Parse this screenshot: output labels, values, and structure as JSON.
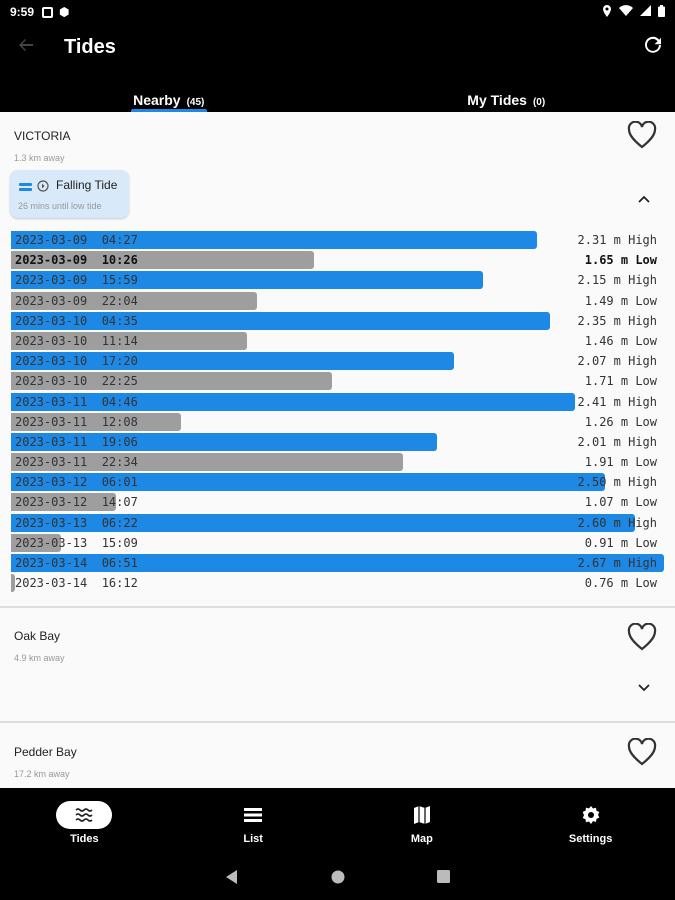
{
  "status_bar": {
    "time": "9:59"
  },
  "app_bar": {
    "title": "Tides"
  },
  "tabs": [
    {
      "label": "Nearby",
      "count": "(45)",
      "active": true
    },
    {
      "label": "My Tides",
      "count": "(0)",
      "active": false
    }
  ],
  "locations": [
    {
      "name": "VICTORIA",
      "distance": "1.3 km away",
      "expanded": true,
      "tide_status": {
        "title": "Falling Tide",
        "subtitle": "26 mins until low tide"
      },
      "tides": [
        {
          "datetime": "2023-03-09  04:27",
          "value": "2.31 m",
          "type": "High",
          "fill": 0.806
        },
        {
          "datetime": "2023-03-09  10:26",
          "value": "1.65 m",
          "type": "Low",
          "fill": 0.464,
          "current": true
        },
        {
          "datetime": "2023-03-09  15:59",
          "value": "2.15 m",
          "type": "High",
          "fill": 0.723
        },
        {
          "datetime": "2023-03-09  22:04",
          "value": "1.49 m",
          "type": "Low",
          "fill": 0.377
        },
        {
          "datetime": "2023-03-10  04:35",
          "value": "2.35 m",
          "type": "High",
          "fill": 0.825
        },
        {
          "datetime": "2023-03-10  11:14",
          "value": "1.46 m",
          "type": "Low",
          "fill": 0.362
        },
        {
          "datetime": "2023-03-10  17:20",
          "value": "2.07 m",
          "type": "High",
          "fill": 0.679
        },
        {
          "datetime": "2023-03-10  22:25",
          "value": "1.71 m",
          "type": "Low",
          "fill": 0.491
        },
        {
          "datetime": "2023-03-11  04:46",
          "value": "2.41 m",
          "type": "High",
          "fill": 0.863
        },
        {
          "datetime": "2023-03-11  12:08",
          "value": "1.26 m",
          "type": "Low",
          "fill": 0.261
        },
        {
          "datetime": "2023-03-11  19:06",
          "value": "2.01 m",
          "type": "High",
          "fill": 0.652
        },
        {
          "datetime": "2023-03-11  22:34",
          "value": "1.91 m",
          "type": "Low",
          "fill": 0.6
        },
        {
          "datetime": "2023-03-12  06:01",
          "value": "2.50 m",
          "type": "High",
          "fill": 0.909
        },
        {
          "datetime": "2023-03-12  14:07",
          "value": "1.07 m",
          "type": "Low",
          "fill": 0.161
        },
        {
          "datetime": "2023-03-13  06:22",
          "value": "2.60 m",
          "type": "High",
          "fill": 0.955
        },
        {
          "datetime": "2023-03-13  15:09",
          "value": "0.91 m",
          "type": "Low",
          "fill": 0.076
        },
        {
          "datetime": "2023-03-14  06:51",
          "value": "2.67 m",
          "type": "High",
          "fill": 1.0
        },
        {
          "datetime": "2023-03-14  16:12",
          "value": "0.76 m",
          "type": "Low",
          "fill": 0.005
        }
      ]
    },
    {
      "name": "Oak Bay",
      "distance": "4.9 km away",
      "expanded": false
    },
    {
      "name": "Pedder Bay",
      "distance": "17.2 km away",
      "expanded": false
    }
  ],
  "bottom_nav": [
    {
      "label": "Tides",
      "icon": "waves-icon",
      "active": true
    },
    {
      "label": "List",
      "icon": "list-icon",
      "active": false
    },
    {
      "label": "Map",
      "icon": "map-icon",
      "active": false
    },
    {
      "label": "Settings",
      "icon": "gear-icon",
      "active": false
    }
  ],
  "colors": {
    "accent": "#1e88e5",
    "low_bar": "#9e9e9e",
    "chip": "#d8eaf9"
  }
}
